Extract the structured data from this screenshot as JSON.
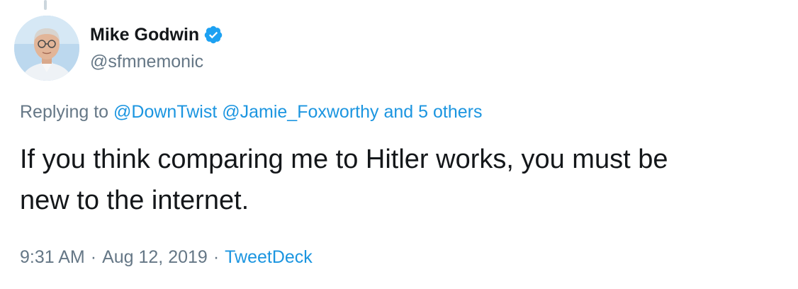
{
  "tweet": {
    "author": {
      "display_name": "Mike Godwin",
      "handle": "@sfmnemonic",
      "verified": true,
      "avatar_icon": "user-avatar"
    },
    "reply": {
      "prefix": "Replying to",
      "mentions": [
        "@DownTwist",
        "@Jamie_Foxworthy"
      ],
      "others": "and 5 others"
    },
    "text_line1": "If you think comparing me to Hitler works, you must be",
    "text_line2": "new to the internet.",
    "meta": {
      "time": "9:31 AM",
      "separator": "·",
      "date": "Aug 12, 2019",
      "source": "TweetDeck"
    }
  },
  "colors": {
    "link": "#1b95e0",
    "secondary_text": "#657786",
    "primary_text": "#14171a",
    "verified_badge": "#1da1f2"
  }
}
